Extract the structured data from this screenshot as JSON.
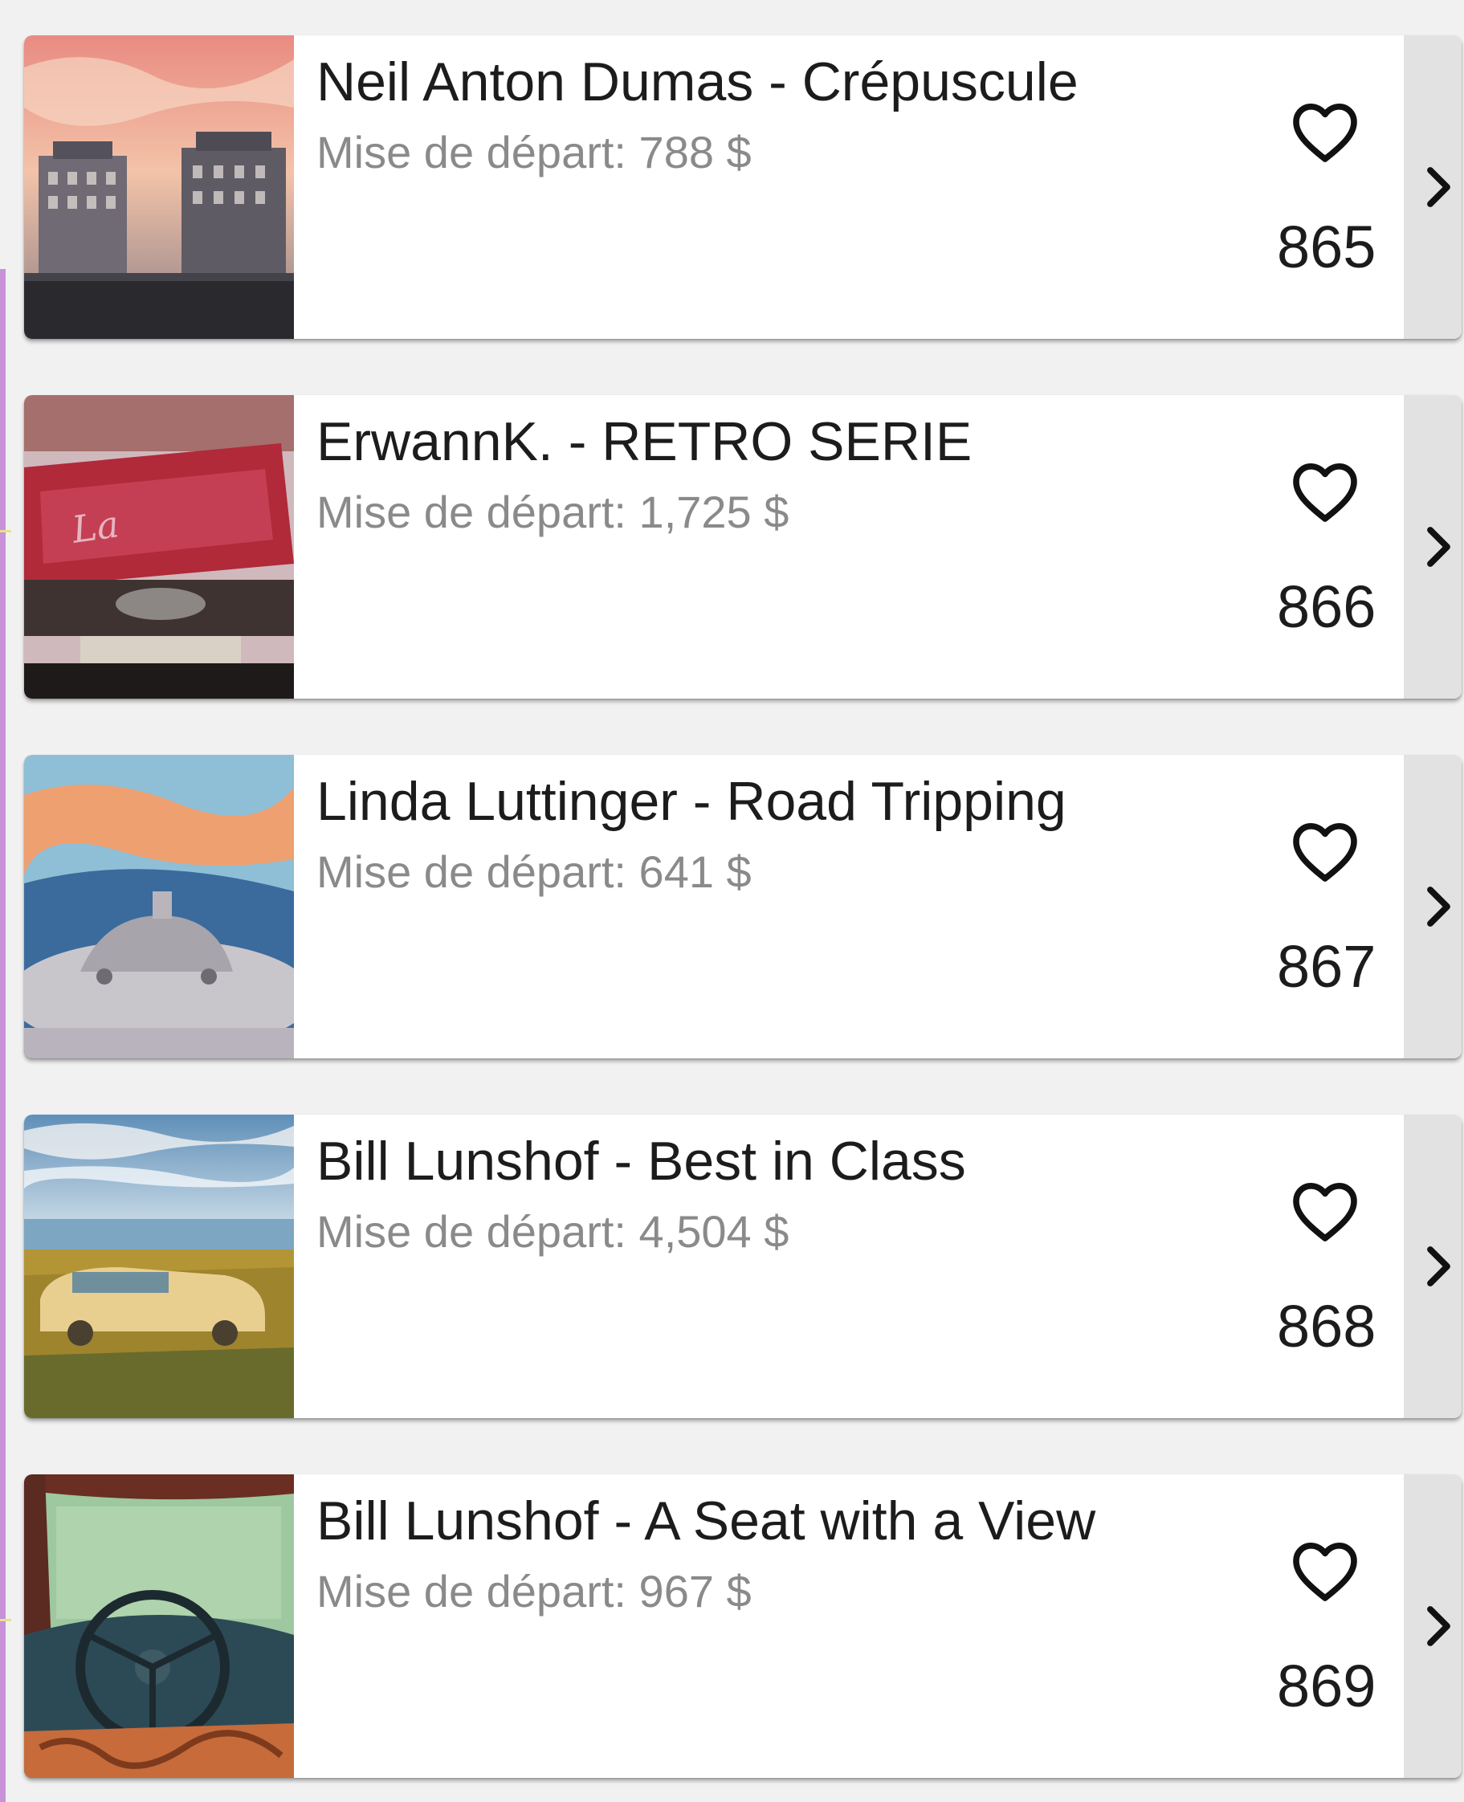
{
  "lots": [
    {
      "title": "Neil Anton Dumas - Crépuscule",
      "price": "Mise de départ: 788 $",
      "count": "865",
      "thumb_colors": [
        "#e9a28f",
        "#f3c3a8",
        "#6e6a70",
        "#2a2a2e"
      ]
    },
    {
      "title": "ErwannK. - RETRO SERIE",
      "price": "Mise de départ: 1,725 $",
      "count": "866",
      "thumb_colors": [
        "#b02a3a",
        "#d9c2c8",
        "#4b3a36",
        "#1f1a1a"
      ]
    },
    {
      "title": "Linda Luttinger - Road Tripping",
      "price": "Mise de départ: 641 $",
      "count": "867",
      "thumb_colors": [
        "#eea070",
        "#7fb7d1",
        "#c9c6cb",
        "#3a6b9c"
      ]
    },
    {
      "title": "Bill Lunshof - Best in Class",
      "price": "Mise de départ: 4,504 $",
      "count": "868",
      "thumb_colors": [
        "#9cc4dc",
        "#c7a343",
        "#e9cf8f",
        "#51612b"
      ]
    },
    {
      "title": "Bill Lunshof - A Seat with a View",
      "price": "Mise de départ: 967 $",
      "count": "869",
      "thumb_colors": [
        "#9ec8a0",
        "#6a2f22",
        "#2c4a55",
        "#c76b3b"
      ]
    }
  ],
  "icons": {
    "like": "heart-outline-icon",
    "open": "chevron-right-icon"
  },
  "colors": {
    "title_text": "#1c1c1c",
    "price_text": "#8a8a8a",
    "chevron_strip": "#e2e2e2",
    "page_background": "#f1f1f1"
  }
}
